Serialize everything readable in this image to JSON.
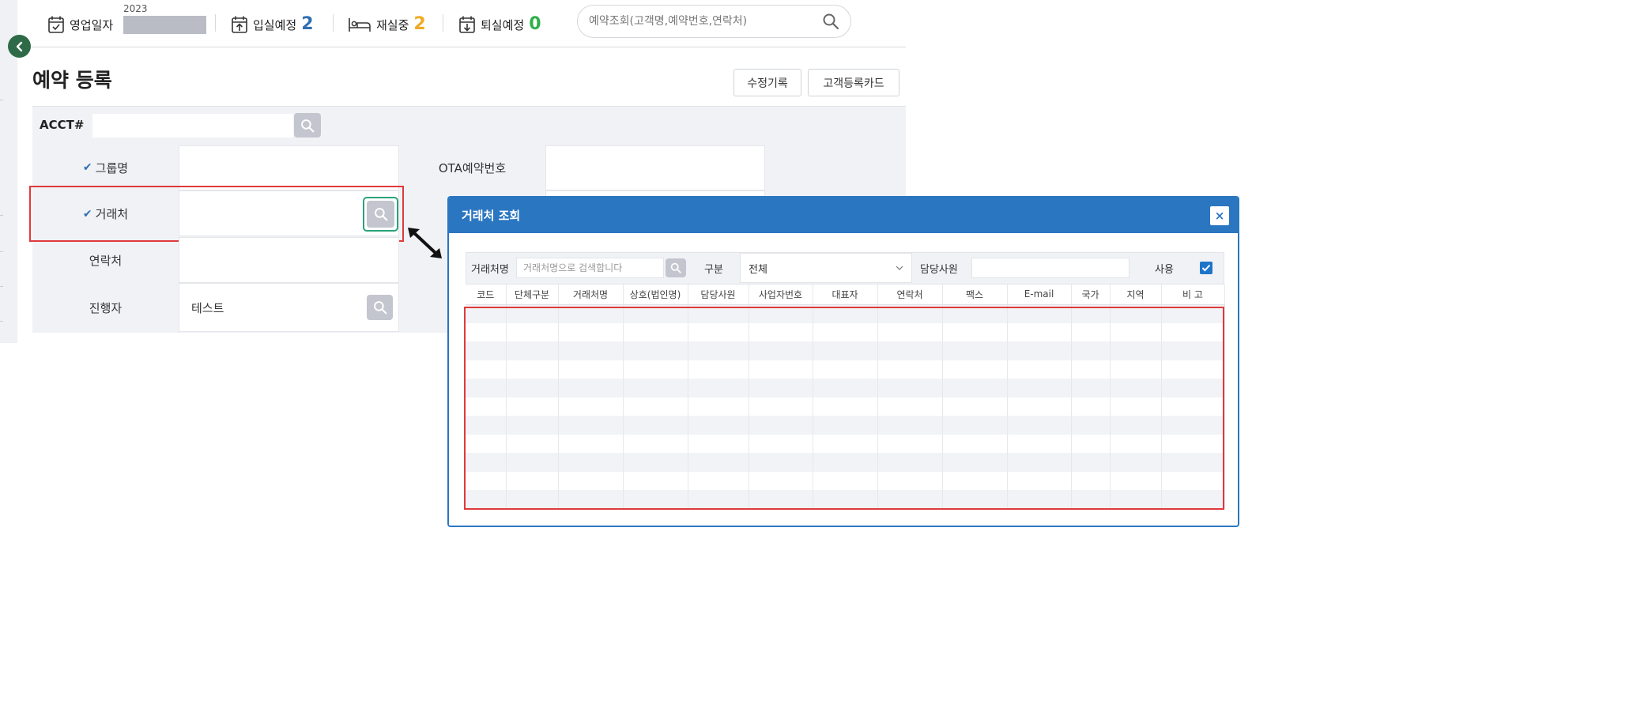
{
  "header": {
    "business_date_label": "영업일자",
    "business_date_year": "2023",
    "checkin_label": "입실예정",
    "checkin_count": "2",
    "staying_label": "재실중",
    "staying_count": "2",
    "checkout_label": "퇴실예정",
    "checkout_count": "0",
    "search_placeholder": "예약조회(고객명,예약번호,연락처)",
    "colors": {
      "checkin": "#2f6fb3",
      "staying": "#f0ab22",
      "checkout": "#2eb04a"
    }
  },
  "page": {
    "title": "예약 등록",
    "edit_history_button": "수정기록",
    "customer_card_button": "고객등록카드"
  },
  "form": {
    "acct_label": "ACCT#",
    "group_label": "그룹명",
    "ota_label": "OTA예약번호",
    "client_label": "거래처",
    "contact_label": "연락처",
    "agent_label": "진행자",
    "agent_value": "테스트"
  },
  "modal": {
    "title": "거래처 조회",
    "close_label": "×",
    "filter": {
      "name_label": "거래처명",
      "name_placeholder": "거래처명으로 검색합니다",
      "type_label": "구분",
      "type_value": "전체",
      "staff_label": "담당사원",
      "use_label": "사용",
      "use_checked": true
    },
    "columns": [
      "코드",
      "단체구분",
      "거래처명",
      "상호(법인명)",
      "담당사원",
      "사업자번호",
      "대표자",
      "연락처",
      "팩스",
      "E-mail",
      "국가",
      "지역",
      "비 고"
    ],
    "row_count": 11
  },
  "annotation_colors": {
    "highlight": "#e0393b",
    "focus": "#2aa37a",
    "accent": "#2b76c1"
  }
}
